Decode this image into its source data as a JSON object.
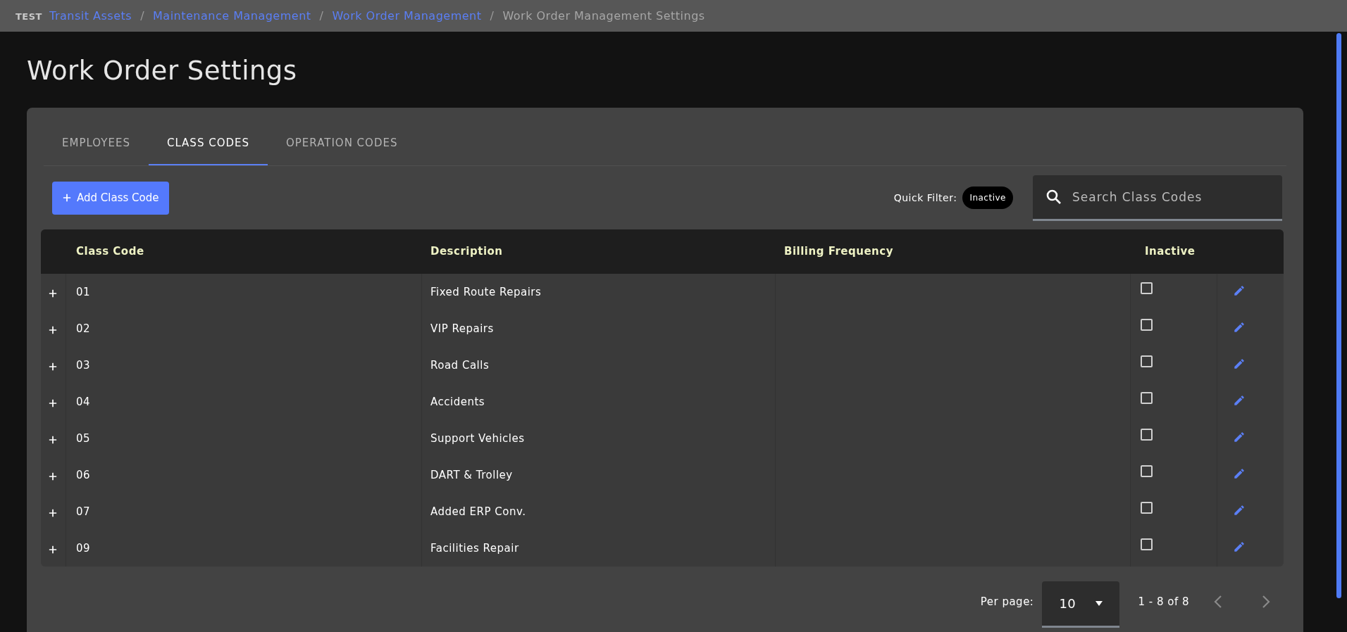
{
  "environment": "TEST",
  "breadcrumb_separator": "/",
  "breadcrumbs": [
    {
      "label": "Transit Assets",
      "current": false
    },
    {
      "label": "Maintenance Management",
      "current": false
    },
    {
      "label": "Work Order Management",
      "current": false
    },
    {
      "label": "Work Order Management Settings",
      "current": true
    }
  ],
  "page_title": "Work Order Settings",
  "tabs": [
    {
      "label": "EMPLOYEES",
      "selected": false
    },
    {
      "label": "CLASS CODES",
      "selected": true
    },
    {
      "label": "OPERATION CODES",
      "selected": false
    }
  ],
  "add_button": "Add Class Code",
  "quick_filter": {
    "label": "Quick Filter:",
    "chip": "Inactive"
  },
  "search": {
    "placeholder": "Search Class Codes"
  },
  "table": {
    "columns": [
      "Class Code",
      "Description",
      "Billing Frequency",
      "Inactive"
    ],
    "rows": [
      {
        "code": "01",
        "description": "Fixed Route Repairs",
        "inactive": false
      },
      {
        "code": "02",
        "description": "VIP Repairs",
        "inactive": false
      },
      {
        "code": "03",
        "description": "Road Calls",
        "inactive": false
      },
      {
        "code": "04",
        "description": "Accidents",
        "inactive": false
      },
      {
        "code": "05",
        "description": "Support Vehicles",
        "inactive": false
      },
      {
        "code": "06",
        "description": "DART & Trolley",
        "inactive": false
      },
      {
        "code": "07",
        "description": "Added ERP Conv.",
        "inactive": false
      },
      {
        "code": "09",
        "description": "Facilities Repair",
        "inactive": false
      }
    ]
  },
  "pagination": {
    "per_page_label": "Per page:",
    "per_page": "10",
    "range": "1 - 8 of 8",
    "prev_disabled": true,
    "next_disabled": true
  }
}
